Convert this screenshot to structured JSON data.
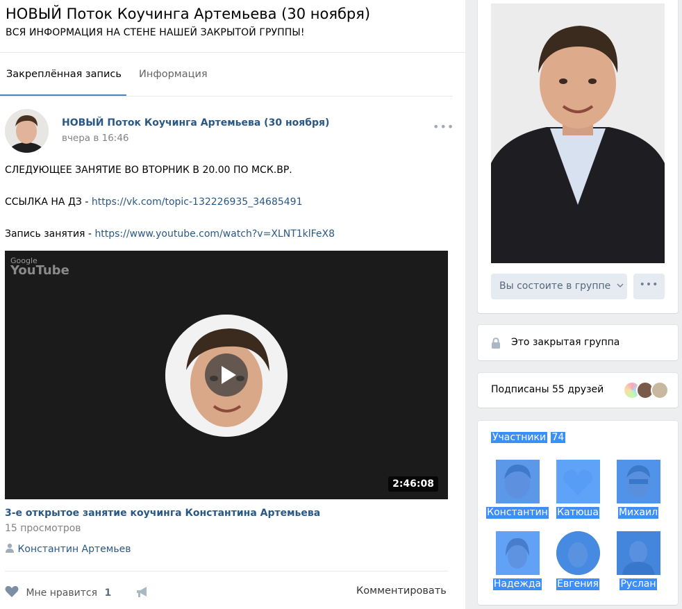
{
  "group": {
    "title": "НОВЫЙ Поток Коучинга Артемьева (30 ноября)",
    "status": "ВСЯ ИНФОРМАЦИЯ НА СТЕНЕ НАШЕЙ ЗАКРЫТОЙ ГРУППЫ!"
  },
  "tabs": [
    {
      "label": "Закреплённая запись",
      "active": true
    },
    {
      "label": "Информация",
      "active": false
    }
  ],
  "post": {
    "author": "НОВЫЙ Поток Коучинга Артемьева (30 ноября)",
    "date": "вчера в 16:46",
    "more": "•••",
    "line1": "СЛЕДУЮЩЕЕ ЗАНЯТИЕ ВО ВТОРНИК В 20.00 ПО МСК.ВР.",
    "line2_prefix": "ССЫЛКА НА ДЗ - ",
    "line2_link": "https://vk.com/topic-132226935_34685491",
    "line3_prefix": "Запись занятия - ",
    "line3_link": "https://www.youtube.com/watch?v=XLNT1klFeX8",
    "video": {
      "logo_top": "Google",
      "logo_bottom": "YouTube",
      "duration": "2:46:08",
      "title": "3-е открытое занятие коучинга Константина Артемьева",
      "views": "15 просмотров",
      "owner": "Константин Артемьев"
    },
    "like_label": "Мне нравится",
    "like_count": "1",
    "comment_label": "Комментировать"
  },
  "sidebar": {
    "member_button": "Вы состоите в группе",
    "more_button": "•••",
    "closed_group": "Это закрытая группа",
    "friends": "Подписаны 55 друзей",
    "members_label": "Участники",
    "members_count": "74",
    "members": [
      {
        "name": "Константин"
      },
      {
        "name": "Катюша"
      },
      {
        "name": "Михаил"
      },
      {
        "name": "Надежда"
      },
      {
        "name": "Евгения"
      },
      {
        "name": "Руслан"
      }
    ]
  },
  "colors": {
    "link": "#2a5885",
    "accent": "#5181b8",
    "selection": "#3e8ef7"
  },
  "icons": [
    "lock-icon",
    "heart-icon",
    "megaphone-icon",
    "user-icon",
    "play-icon",
    "chevron-down-icon",
    "youtube-logo"
  ]
}
